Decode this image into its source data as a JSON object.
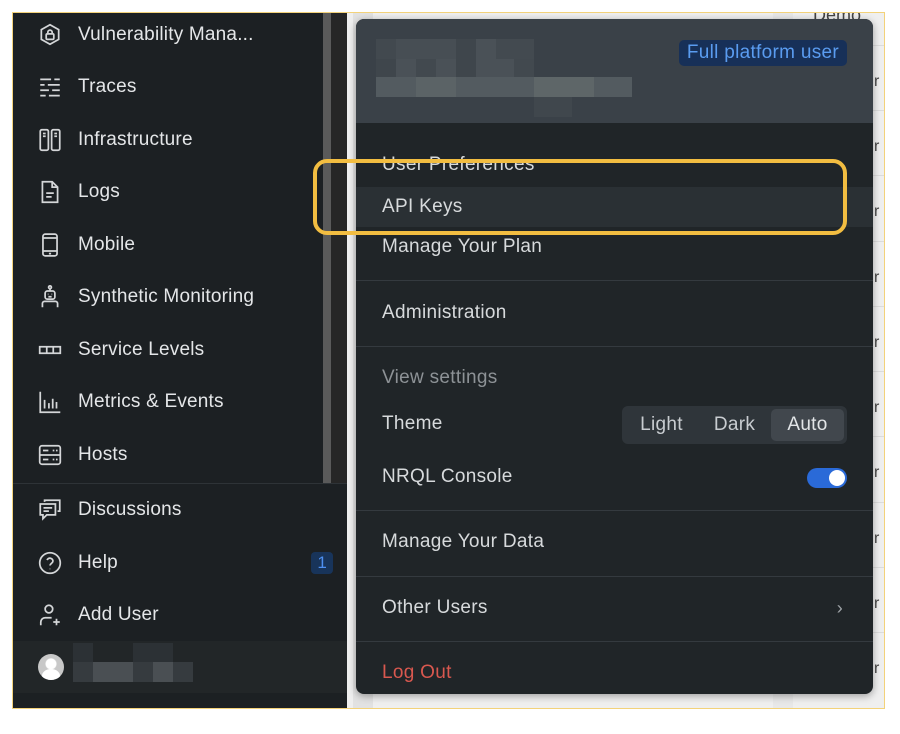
{
  "sidebar": {
    "nav_items": [
      {
        "label": "Vulnerability Mana...",
        "icon": "shield-lock-icon"
      },
      {
        "label": "Traces",
        "icon": "traces-icon"
      },
      {
        "label": "Infrastructure",
        "icon": "servers-icon"
      },
      {
        "label": "Logs",
        "icon": "document-icon"
      },
      {
        "label": "Mobile",
        "icon": "mobile-icon"
      },
      {
        "label": "Synthetic Monitoring",
        "icon": "robot-icon"
      },
      {
        "label": "Service Levels",
        "icon": "service-levels-icon"
      },
      {
        "label": "Metrics & Events",
        "icon": "bar-chart-icon"
      },
      {
        "label": "Hosts",
        "icon": "hosts-icon"
      }
    ],
    "footer_items": [
      {
        "label": "Discussions",
        "icon": "chat-icon"
      },
      {
        "label": "Help",
        "icon": "help-icon",
        "badge": "1"
      },
      {
        "label": "Add User",
        "icon": "add-user-icon"
      }
    ],
    "user": {
      "avatar": "avatar-icon",
      "name": "[redacted]"
    }
  },
  "user_menu": {
    "header": {
      "name": "[redacted]",
      "role_badge": "Full platform user"
    },
    "items": [
      {
        "label": "User Preferences"
      },
      {
        "label": "API Keys",
        "highlighted": true
      },
      {
        "label": "Manage Your Plan"
      },
      {
        "label": "Administration"
      }
    ],
    "view_settings": {
      "section_label": "View settings",
      "theme": {
        "label": "Theme",
        "options": [
          "Light",
          "Dark",
          "Auto"
        ],
        "selected": "Auto"
      },
      "nrql_console": {
        "label": "NRQL Console",
        "enabled": true
      }
    },
    "manage_data": "Manage Your Data",
    "other_users": "Other Users",
    "log_out": "Log Out"
  },
  "background": {
    "top_text": "Demo",
    "row_char": "r"
  },
  "colors": {
    "accent_highlight": "#f2bd41",
    "logout": "#d9584f",
    "toggle_on": "#2a6ad8",
    "badge_text": "#5a9cf0"
  }
}
